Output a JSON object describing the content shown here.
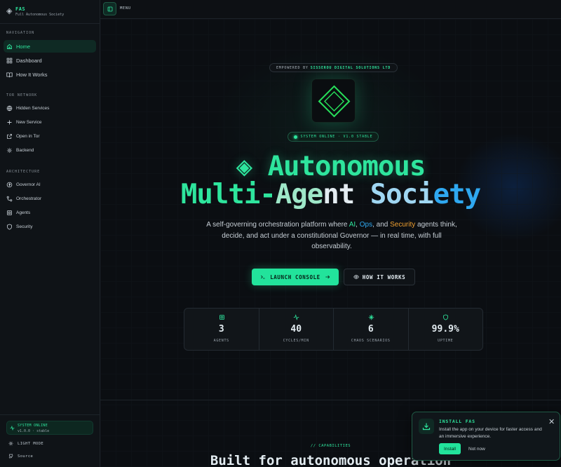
{
  "brand": {
    "name": "FAS",
    "subtitle": "Full Autonomous Society",
    "icon": "diamond-icon"
  },
  "sidebar": {
    "navigation_title": "NAVIGATION",
    "navigation": [
      {
        "label": "Home",
        "icon": "home-icon",
        "active": true
      },
      {
        "label": "Dashboard",
        "icon": "grid-icon"
      },
      {
        "label": "How It Works",
        "icon": "book-icon"
      }
    ],
    "tor_title": "TOR NETWORK",
    "tor": [
      {
        "label": "Hidden Services",
        "icon": "globe-icon"
      },
      {
        "label": "New Service",
        "icon": "plus-icon"
      },
      {
        "label": "Open in Tor",
        "icon": "external-link-icon"
      },
      {
        "label": "Backend",
        "icon": "gear-icon"
      }
    ],
    "architecture_title": "ARCHITECTURE",
    "architecture": [
      {
        "label": "Governor AI",
        "icon": "governor-icon"
      },
      {
        "label": "Orchestrator",
        "icon": "workflow-icon"
      },
      {
        "label": "Agents",
        "icon": "cpu-icon"
      },
      {
        "label": "Security",
        "icon": "shield-icon"
      }
    ],
    "status": {
      "title": "SYSTEM ONLINE",
      "version": "v1.0.0 · stable"
    },
    "light_mode": "LIGHT MODE",
    "source": "Source"
  },
  "topbar": {
    "menu_label": "MENU"
  },
  "hero": {
    "empowered_prefix": "EMPOWERED BY",
    "empowered_by": "SISSEROU DIGITAL SOLUTIONS LTD",
    "status_pill": "SYSTEM ONLINE · V1.0 STABLE",
    "title_line1": "◈ Autonomous",
    "title_line2_a": "Multi-",
    "title_line2_b": "Age",
    "title_line2_c": "nt ",
    "title_line2_d": "Soci",
    "title_line2_e": "ety",
    "desc_1": "A self-governing orchestration platform where ",
    "desc_ai": "AI",
    "desc_2": ", ",
    "desc_ops": "Ops",
    "desc_3": ", and ",
    "desc_sec": "Security",
    "desc_4": " agents think, decide, and act under a constitutional Governor — in real time, with full observability.",
    "primary_button": "LAUNCH CONSOLE",
    "secondary_button": "HOW IT WORKS"
  },
  "stats": [
    {
      "value": "3",
      "label": "AGENTS",
      "icon": "cpu-icon"
    },
    {
      "value": "40",
      "label": "CYCLES/MIN",
      "icon": "activity-icon"
    },
    {
      "value": "6",
      "label": "CHAOS SCENARIOS",
      "icon": "sparkle-icon"
    },
    {
      "value": "99.9%",
      "label": "UPTIME",
      "icon": "shield-icon"
    }
  ],
  "capabilities": {
    "tag": "// CAPABILITIES",
    "title": "Built for autonomous operation"
  },
  "toast": {
    "title": "INSTALL FAS",
    "body": "Install the app on your device for faster access and an immersive experience.",
    "install": "Install",
    "dismiss": "Not now"
  },
  "colors": {
    "accent": "#2ee59d",
    "blue": "#2fa8f0",
    "orange": "#f0a030",
    "background": "#0b0e12"
  }
}
